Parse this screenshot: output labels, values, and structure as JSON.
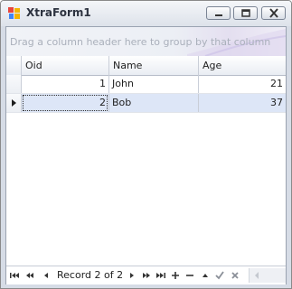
{
  "window": {
    "title": "XtraForm1"
  },
  "grid": {
    "group_panel_text": "Drag a column header here to group by that column",
    "columns": [
      "Oid",
      "Name",
      "Age"
    ],
    "rows": [
      {
        "oid": "1",
        "name": "John",
        "age": "21"
      },
      {
        "oid": "2",
        "name": "Bob",
        "age": "37"
      }
    ],
    "focused_row": 2
  },
  "navigator": {
    "record_text": "Record 2 of 2"
  },
  "colors": {
    "selected_row": "#dde6f7",
    "border": "#9aa3b1",
    "title_text": "#2d3340"
  }
}
